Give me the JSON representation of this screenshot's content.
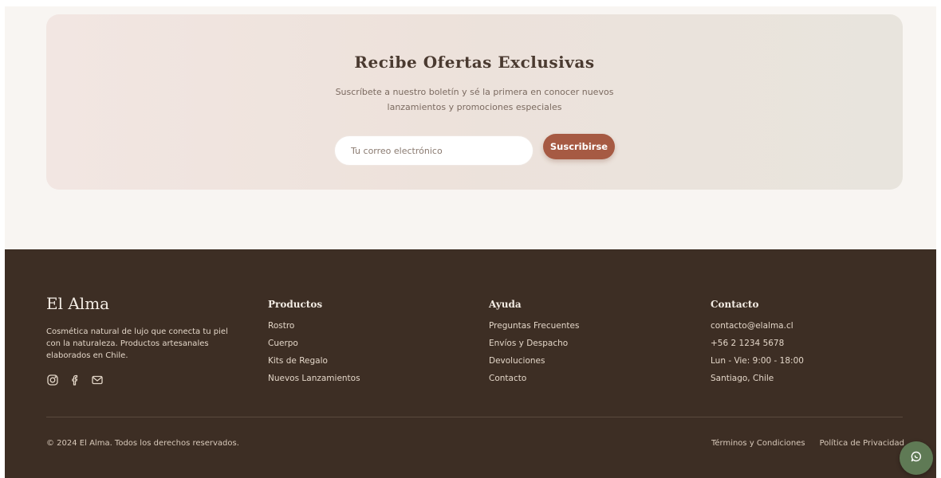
{
  "newsletter": {
    "title": "Recibe Ofertas Exclusivas",
    "subtitle": "Suscríbete a nuestro boletín y sé la primera en conocer nuevos lanzamientos y promociones especiales",
    "email_placeholder": "Tu correo electrónico",
    "subscribe_label": "Suscribirse"
  },
  "footer": {
    "brand": {
      "name": "El Alma",
      "description": "Cosmética natural de lujo que conecta tu piel con la naturaleza. Productos artesanales elaborados en Chile."
    },
    "social_icons": [
      "instagram-icon",
      "facebook-icon",
      "mail-icon"
    ],
    "products": {
      "title": "Productos",
      "items": [
        "Rostro",
        "Cuerpo",
        "Kits de Regalo",
        "Nuevos Lanzamientos"
      ]
    },
    "help": {
      "title": "Ayuda",
      "items": [
        "Preguntas Frecuentes",
        "Envíos y Despacho",
        "Devoluciones",
        "Contacto"
      ]
    },
    "contact": {
      "title": "Contacto",
      "items": [
        "contacto@elalma.cl",
        "+56 2 1234 5678",
        "Lun - Vie: 9:00 - 18:00",
        "Santiago, Chile"
      ]
    },
    "copyright": "© 2024 El Alma. Todos los derechos reservados.",
    "legal": {
      "terms": "Términos y Condiciones",
      "privacy": "Política de Privacidad"
    }
  },
  "chat": {
    "icon": "chat-icon"
  },
  "colors": {
    "accent": "#a65a43",
    "footer_bg": "#3d2e24",
    "chat_bg": "#5f7a55",
    "page_bg": "#f8f5f2"
  }
}
